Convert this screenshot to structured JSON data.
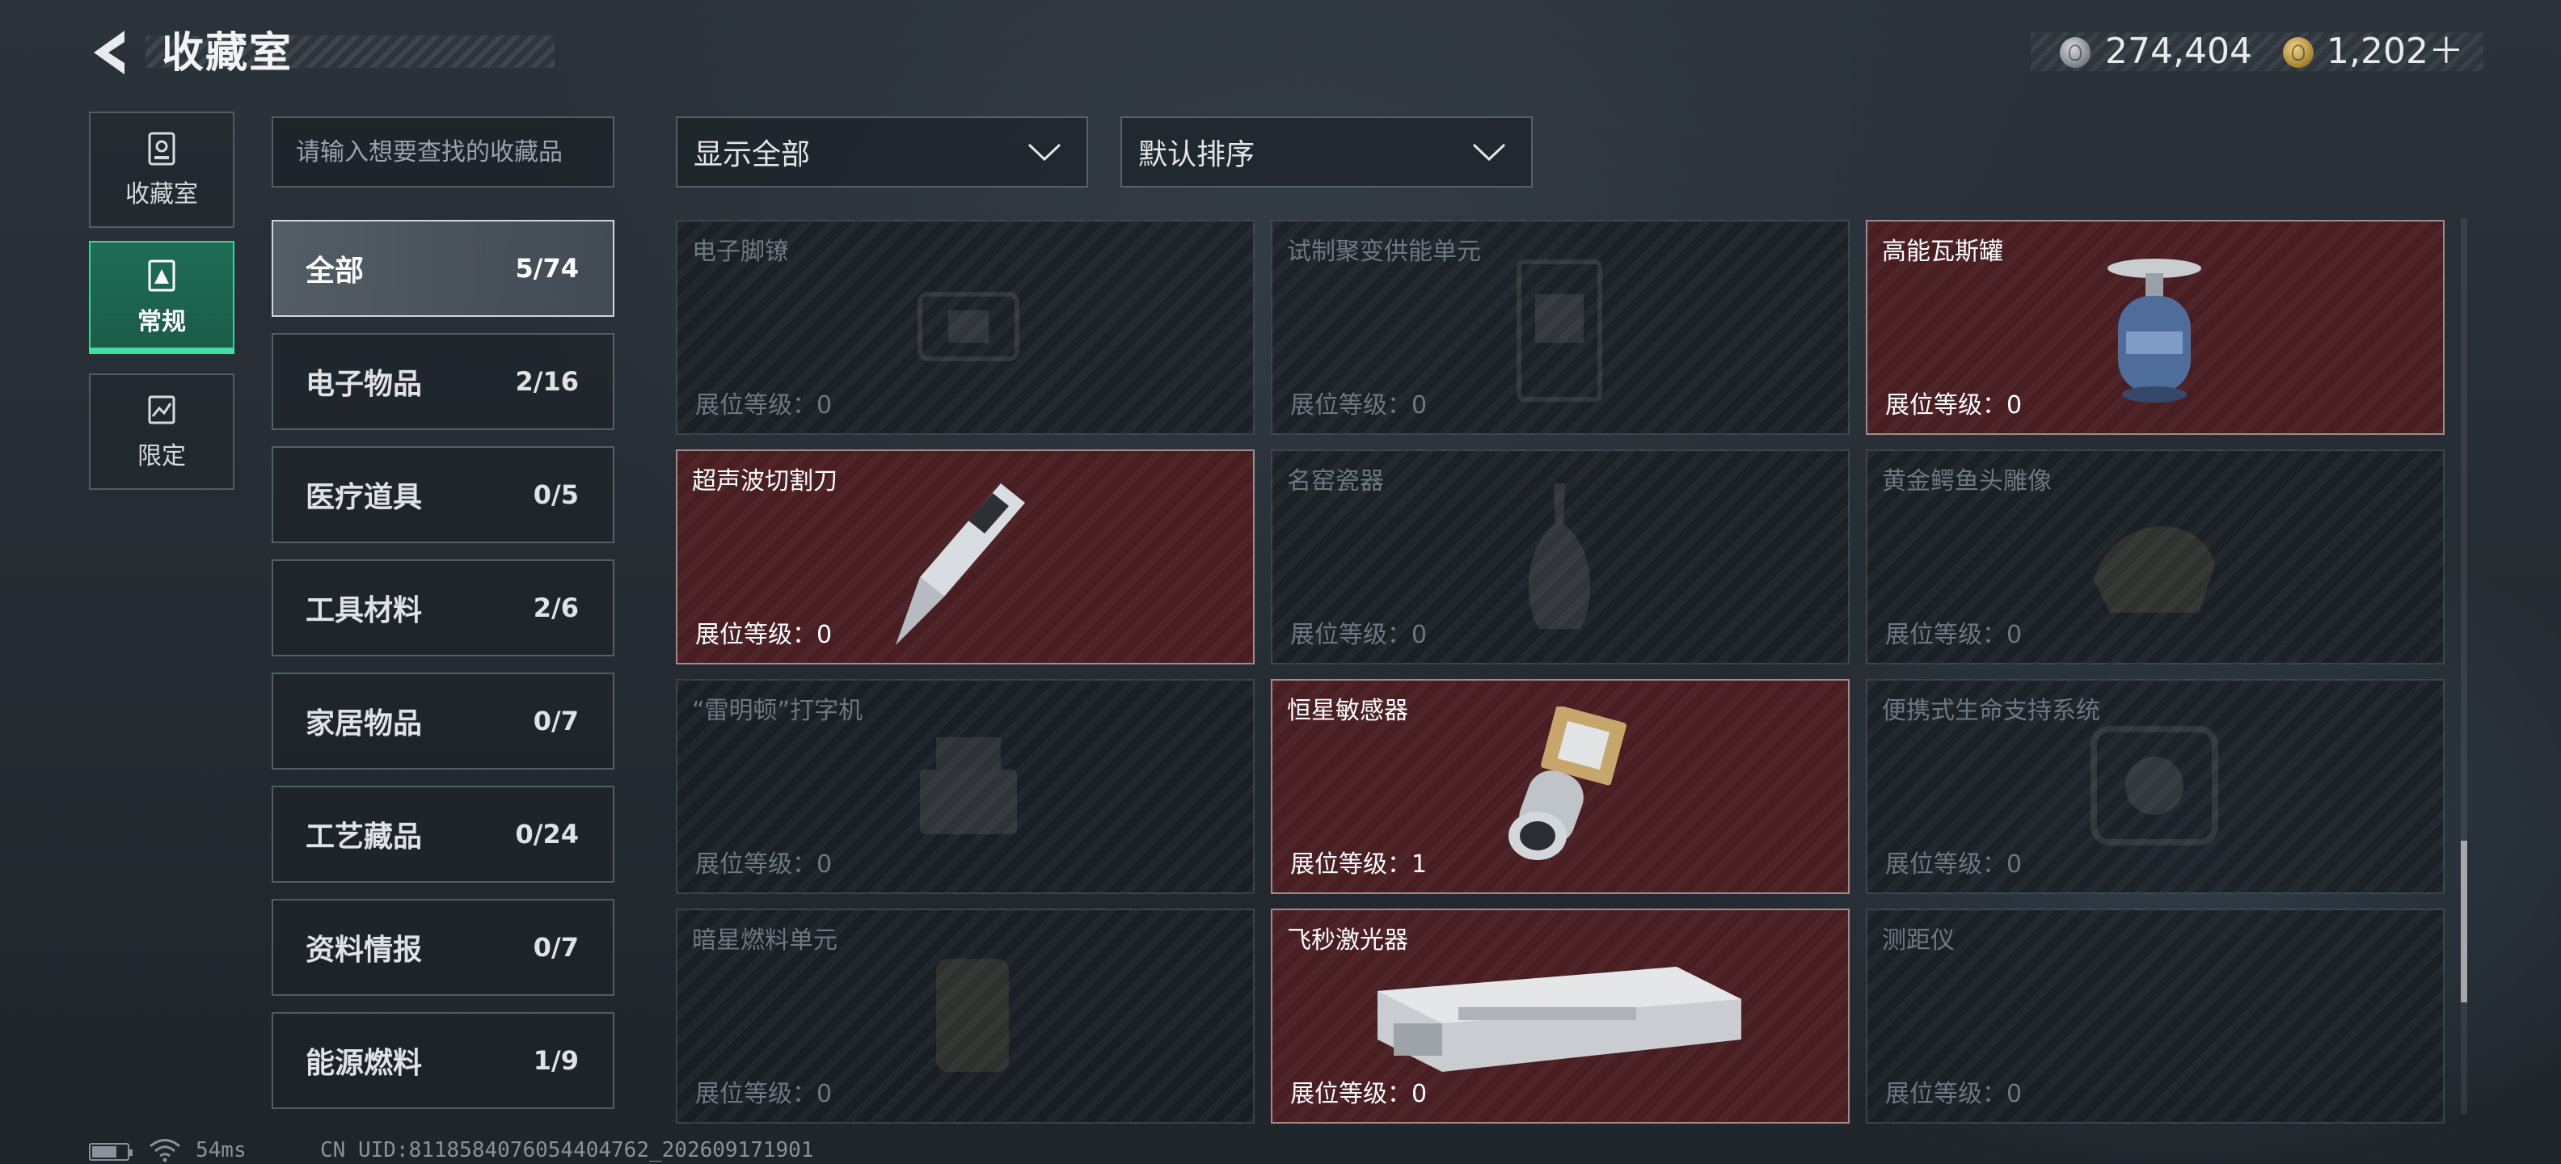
{
  "header": {
    "title": "收藏室"
  },
  "currency": [
    {
      "icon": "silver-coin-icon",
      "value": "274,404"
    },
    {
      "icon": "gold-coin-icon",
      "value": "1,202＋"
    }
  ],
  "rail": [
    {
      "label": "收藏室",
      "icon": "collection-room-icon",
      "active": false
    },
    {
      "label": "常规",
      "icon": "regular-icon",
      "active": true
    },
    {
      "label": "限定",
      "icon": "limited-icon",
      "active": false
    }
  ],
  "search": {
    "placeholder": "请输入想要查找的收藏品"
  },
  "categories": [
    {
      "name": "全部",
      "count": "5/74",
      "active": true
    },
    {
      "name": "电子物品",
      "count": "2/16"
    },
    {
      "name": "医疗道具",
      "count": "0/5"
    },
    {
      "name": "工具材料",
      "count": "2/6"
    },
    {
      "name": "家居物品",
      "count": "0/7"
    },
    {
      "name": "工艺藏品",
      "count": "0/24"
    },
    {
      "name": "资料情报",
      "count": "0/7"
    },
    {
      "name": "能源燃料",
      "count": "1/9"
    }
  ],
  "filters": {
    "show": "显示全部",
    "sort": "默认排序"
  },
  "items": [
    {
      "name": "电子脚镣",
      "level": "展位等级：0",
      "owned": false,
      "icon": "electronic-shackle-icon"
    },
    {
      "name": "试制聚变供能单元",
      "level": "展位等级：0",
      "owned": false,
      "icon": "fusion-power-unit-icon"
    },
    {
      "name": "高能瓦斯罐",
      "level": "展位等级：0",
      "owned": true,
      "icon": "gas-canister-icon"
    },
    {
      "name": "超声波切割刀",
      "level": "展位等级：0",
      "owned": true,
      "icon": "ultrasonic-cutter-icon"
    },
    {
      "name": "名窑瓷器",
      "level": "展位等级：0",
      "owned": false,
      "icon": "porcelain-vase-icon"
    },
    {
      "name": "黄金鳄鱼头雕像",
      "level": "展位等级：0",
      "owned": false,
      "icon": "gold-crocodile-statue-icon"
    },
    {
      "name": "“雷明顿”打字机",
      "level": "展位等级：0",
      "owned": false,
      "icon": "typewriter-icon"
    },
    {
      "name": "恒星敏感器",
      "level": "展位等级：1",
      "owned": true,
      "icon": "star-sensor-icon"
    },
    {
      "name": "便携式生命支持系统",
      "level": "展位等级：0",
      "owned": false,
      "icon": "life-support-icon"
    },
    {
      "name": "暗星燃料单元",
      "level": "展位等级：0",
      "owned": false,
      "icon": "fuel-cell-icon"
    },
    {
      "name": "飞秒激光器",
      "level": "展位等级：0",
      "owned": true,
      "icon": "femtosecond-laser-icon"
    },
    {
      "name": "测距仪",
      "level": "展位等级：0",
      "owned": false,
      "icon": "rangefinder-icon"
    }
  ],
  "footer": {
    "ping": "54ms",
    "uid": "CN UID:8118584076054404762_202609171901"
  },
  "colors": {
    "accent": "#3fe0a4",
    "owned_card": "#4a1f24"
  }
}
